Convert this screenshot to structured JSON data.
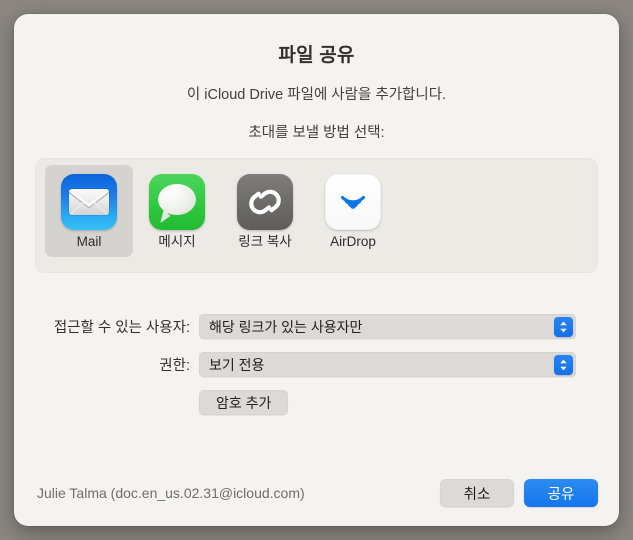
{
  "dialog": {
    "title": "파일 공유",
    "subtitle": "이 iCloud Drive 파일에 사람을 추가합니다.",
    "prompt": "초대를 보낼 방법 선택:"
  },
  "share_methods": {
    "selected": "Mail",
    "items": [
      {
        "id": "mail",
        "label": "Mail",
        "icon": "mail-icon",
        "selected": true
      },
      {
        "id": "messages",
        "label": "메시지",
        "icon": "messages-icon",
        "selected": false
      },
      {
        "id": "copy-link",
        "label": "링크 복사",
        "icon": "link-icon",
        "selected": false
      },
      {
        "id": "airdrop",
        "label": "AirDrop",
        "icon": "airdrop-icon",
        "selected": false
      }
    ]
  },
  "options": {
    "access": {
      "label": "접근할 수 있는 사용자:",
      "value": "해당 링크가 있는 사용자만"
    },
    "permission": {
      "label": "권한:",
      "value": "보기 전용"
    },
    "add_password_label": "암호 추가"
  },
  "footer": {
    "account": "Julie Talma (doc.en_us.02.31@icloud.com)",
    "cancel_label": "취소",
    "share_label": "공유"
  },
  "colors": {
    "accent": "#1376ee",
    "dialog_bg": "#f4f3f0",
    "backdrop": "#8c8881",
    "panel_bg": "#eceae5",
    "field_bg": "#dbdad8"
  }
}
